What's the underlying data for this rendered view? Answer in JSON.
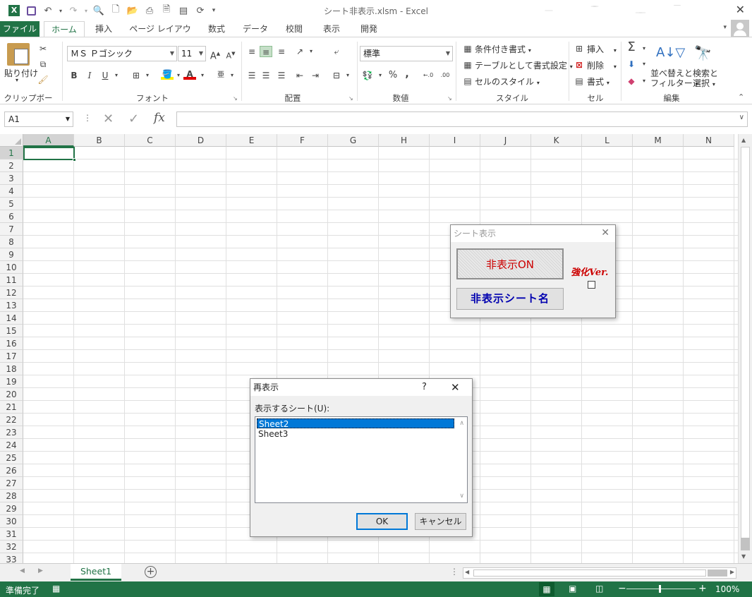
{
  "titlebar": {
    "title": "シート非表示.xlsm - Excel"
  },
  "tabs": [
    {
      "label": "ファイル"
    },
    {
      "label": "ホーム"
    },
    {
      "label": "挿入"
    },
    {
      "label": "ページ レイアウト"
    },
    {
      "label": "数式"
    },
    {
      "label": "データ"
    },
    {
      "label": "校閲"
    },
    {
      "label": "表示"
    },
    {
      "label": "開発"
    }
  ],
  "ribbon": {
    "clipboard": {
      "paste": "貼り付け",
      "group": "クリップボード"
    },
    "font": {
      "name": "ＭＳ Ｐゴシック",
      "size": "11",
      "group": "フォント",
      "bold": "B",
      "italic": "I",
      "underline": "U",
      "grow": "A",
      "shrink": "A"
    },
    "alignment": {
      "group": "配置"
    },
    "number": {
      "format": "標準",
      "group": "数値",
      "percent": "%",
      "comma": ","
    },
    "styles": {
      "conditional": "条件付き書式",
      "table": "テーブルとして書式設定",
      "cell": "セルのスタイル",
      "group": "スタイル"
    },
    "cells": {
      "insert": "挿入",
      "delete": "削除",
      "format": "書式",
      "group": "セル"
    },
    "editing": {
      "sort1": "並べ替えと",
      "sort2": "フィルター",
      "find1": "検索と",
      "find2": "選択",
      "group": "編集"
    }
  },
  "formulabar": {
    "namebox": "A1",
    "fx": "fx",
    "formula": ""
  },
  "columns": [
    "A",
    "B",
    "C",
    "D",
    "E",
    "F",
    "G",
    "H",
    "I",
    "J",
    "K",
    "L",
    "M",
    "N"
  ],
  "rows": [
    "1",
    "2",
    "3",
    "4",
    "5",
    "6",
    "7",
    "8",
    "9",
    "10",
    "11",
    "12",
    "13",
    "14",
    "15",
    "16",
    "17",
    "18",
    "19",
    "20",
    "21",
    "22",
    "23",
    "24",
    "25",
    "26",
    "27",
    "28",
    "29",
    "30",
    "31",
    "32",
    "33"
  ],
  "sheettabs": {
    "active": "Sheet1"
  },
  "statusbar": {
    "ready": "準備完了",
    "zoom": "100%"
  },
  "userform": {
    "title": "シート表示",
    "btn_on": "非表示ON",
    "btn_names": "非表示シート名",
    "label_ver": "強化Ver."
  },
  "unhide": {
    "title": "再表示",
    "help": "?",
    "label": "表示するシート(U):",
    "items": [
      "Sheet2",
      "Sheet3"
    ],
    "ok": "OK",
    "cancel": "キャンセル"
  },
  "colors": {
    "excel_green": "#217346",
    "selection_blue": "#0078d7",
    "button_red": "#cc0000",
    "button_blue": "#0000b0"
  }
}
